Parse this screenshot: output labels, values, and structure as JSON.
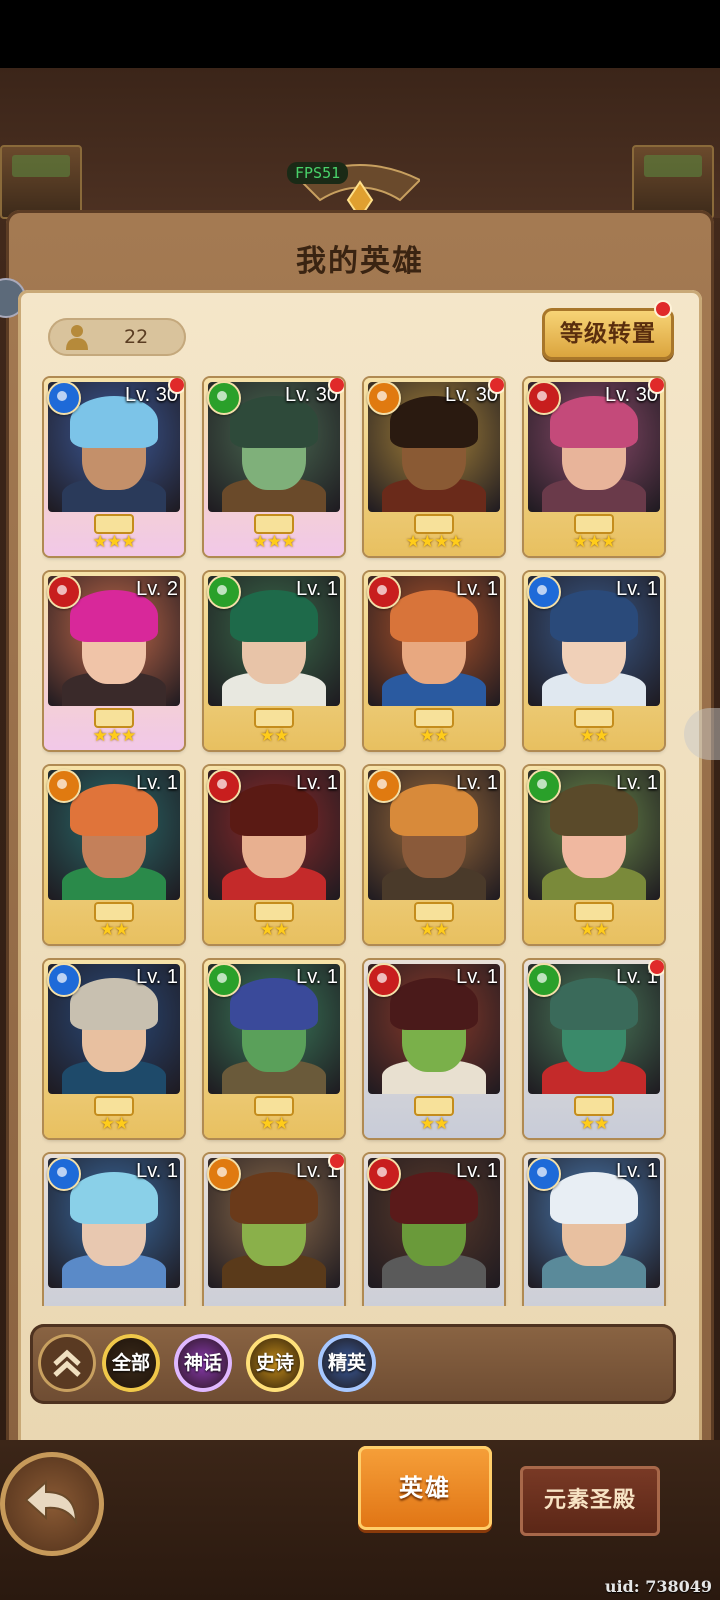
{
  "hud": {
    "fps": "FPS51"
  },
  "header": {
    "title": "我的英雄"
  },
  "hero_count": "22",
  "level_transfer_label": "等级转置",
  "heroes": [
    {
      "level": "Lv. 30",
      "element": "water",
      "stars": "★★★",
      "rarity": "mythic",
      "dot": true,
      "bg": "#3c5a9a",
      "hair": "#7cc4e8",
      "skin": "#c4906a",
      "cloth": "#2a3a5a"
    },
    {
      "level": "Lv. 30",
      "element": "nature",
      "stars": "★★★",
      "rarity": "mythic",
      "dot": true,
      "bg": "#4a6a52",
      "hair": "#2e4a3a",
      "skin": "#7fb07a",
      "cloth": "#6a4a2a"
    },
    {
      "level": "Lv. 30",
      "element": "light",
      "stars": "★★★★",
      "rarity": "epic",
      "dot": true,
      "bg": "#a8843a",
      "hair": "#2a1a10",
      "skin": "#8a5a34",
      "cloth": "#6a2a1a"
    },
    {
      "level": "Lv. 30",
      "element": "fire",
      "stars": "★★★",
      "rarity": "epic",
      "dot": true,
      "bg": "#8a4a6a",
      "hair": "#c44a7a",
      "skin": "#e8b49a",
      "cloth": "#6a3a4a"
    },
    {
      "level": "Lv. 2",
      "element": "fire",
      "stars": "★★★",
      "rarity": "mythic",
      "dot": false,
      "bg": "#c46a4a",
      "hair": "#d8289a",
      "skin": "#f0c4a8",
      "cloth": "#3a2a2a"
    },
    {
      "level": "Lv. 1",
      "element": "nature",
      "stars": "★★",
      "rarity": "epic",
      "dot": false,
      "bg": "#3a6a4a",
      "hair": "#1e6a4a",
      "skin": "#e8c4a8",
      "cloth": "#e8e8e0"
    },
    {
      "level": "Lv. 1",
      "element": "fire",
      "stars": "★★",
      "rarity": "epic",
      "dot": false,
      "bg": "#b0542a",
      "hair": "#d8743a",
      "skin": "#e8a880",
      "cloth": "#2a5aa0"
    },
    {
      "level": "Lv. 1",
      "element": "water",
      "stars": "★★",
      "rarity": "epic",
      "dot": false,
      "bg": "#3a5a8a",
      "hair": "#2a4a7a",
      "skin": "#f0d0b8",
      "cloth": "#e0e8f0"
    },
    {
      "level": "Lv. 1",
      "element": "light",
      "stars": "★★",
      "rarity": "epic",
      "dot": false,
      "bg": "#2a6a6a",
      "hair": "#e0743a",
      "skin": "#c4805a",
      "cloth": "#2a8a4a"
    },
    {
      "level": "Lv. 1",
      "element": "fire",
      "stars": "★★",
      "rarity": "epic",
      "dot": false,
      "bg": "#8a2a2a",
      "hair": "#5a1a14",
      "skin": "#e8b090",
      "cloth": "#c42a2a"
    },
    {
      "level": "Lv. 1",
      "element": "light",
      "stars": "★★",
      "rarity": "epic",
      "dot": false,
      "bg": "#9a6a3a",
      "hair": "#d88a3a",
      "skin": "#8a5a3a",
      "cloth": "#4a3a2a"
    },
    {
      "level": "Lv. 1",
      "element": "nature",
      "stars": "★★",
      "rarity": "epic",
      "dot": false,
      "bg": "#6a8a4a",
      "hair": "#5a4a2a",
      "skin": "#f0b8a0",
      "cloth": "#7a8a3a"
    },
    {
      "level": "Lv. 1",
      "element": "water",
      "stars": "★★",
      "rarity": "epic",
      "dot": false,
      "bg": "#2a4a7a",
      "hair": "#c8c0b0",
      "skin": "#e8c0a0",
      "cloth": "#1e4a6a"
    },
    {
      "level": "Lv. 1",
      "element": "nature",
      "stars": "★★",
      "rarity": "epic",
      "dot": false,
      "bg": "#3a7a5a",
      "hair": "#3a4a9a",
      "skin": "#5aa05a",
      "cloth": "#6a5a3a"
    },
    {
      "level": "Lv. 1",
      "element": "fire",
      "stars": "★★",
      "rarity": "elite",
      "dot": false,
      "bg": "#8a3a2a",
      "hair": "#4a1a1a",
      "skin": "#7ab04a",
      "cloth": "#e8e0d0"
    },
    {
      "level": "Lv. 1",
      "element": "nature",
      "stars": "★★",
      "rarity": "elite",
      "dot": true,
      "bg": "#4a7a5a",
      "hair": "#3a6a5a",
      "skin": "#3a8a6a",
      "cloth": "#c42a2a"
    },
    {
      "level": "Lv. 1",
      "element": "water",
      "stars": "",
      "rarity": "elite",
      "dot": false,
      "bg": "#3a6aa0",
      "hair": "#8ad0e8",
      "skin": "#e8c8b0",
      "cloth": "#5a8ac8"
    },
    {
      "level": "Lv. 1",
      "element": "light",
      "stars": "",
      "rarity": "elite",
      "dot": true,
      "bg": "#8a6a4a",
      "hair": "#6a3a1a",
      "skin": "#8ab04a",
      "cloth": "#5a3a1a"
    },
    {
      "level": "Lv. 1",
      "element": "fire",
      "stars": "",
      "rarity": "elite",
      "dot": false,
      "bg": "#5a3a2a",
      "hair": "#5a1a1a",
      "skin": "#6a9a3a",
      "cloth": "#5a5a5a"
    },
    {
      "level": "Lv. 1",
      "element": "water",
      "stars": "",
      "rarity": "elite",
      "dot": false,
      "bg": "#4a7ab0",
      "hair": "#e8eef4",
      "skin": "#e8c0a0",
      "cloth": "#5a8a9a"
    }
  ],
  "filters": [
    {
      "label": "全部",
      "key": "all",
      "color": "#3a2a1a",
      "ring": "#f0c84a"
    },
    {
      "label": "神话",
      "key": "mythic",
      "color": "#8a3ab0",
      "ring": "#e0b8ff"
    },
    {
      "label": "史诗",
      "key": "epic",
      "color": "#c08a1a",
      "ring": "#ffe07a"
    },
    {
      "label": "精英",
      "key": "elite",
      "color": "#3a5a9a",
      "ring": "#a8c8ff"
    }
  ],
  "tabs": {
    "heroes": "英雄",
    "temple": "元素圣殿"
  },
  "uid": "uid: 738049",
  "colors": {
    "water": "#1e6ad8",
    "nature": "#2aa02a",
    "light": "#e07a10",
    "fire": "#c81e1e"
  }
}
